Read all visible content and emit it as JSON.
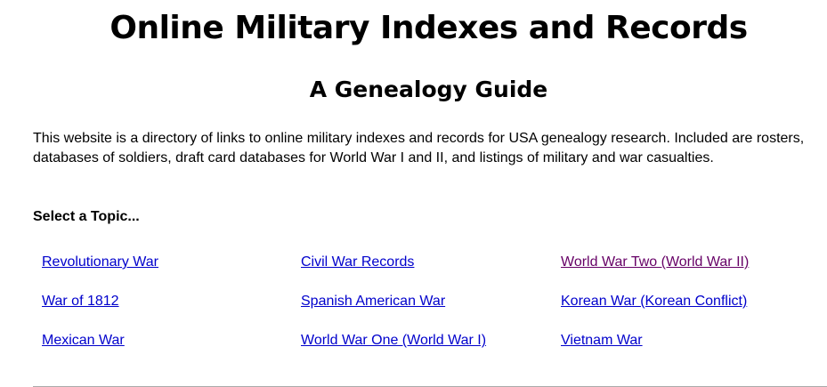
{
  "header": {
    "title": "Online Military Indexes and Records",
    "subtitle": "A Genealogy Guide"
  },
  "intro": {
    "text": "This website is a directory of links to online military indexes and records for USA genealogy research. Included are rosters, databases of soldiers, draft card databases for World War I and II, and listings of military and war casualties."
  },
  "topics": {
    "heading": "Select a Topic...",
    "link_color": "#0000cc",
    "visited_color": "#660066",
    "rows": [
      [
        {
          "label": "Revolutionary War",
          "visited": false
        },
        {
          "label": "Civil War Records",
          "visited": false
        },
        {
          "label": "World War Two (World War II)",
          "visited": true
        }
      ],
      [
        {
          "label": "War of 1812",
          "visited": false
        },
        {
          "label": "Spanish American War",
          "visited": false
        },
        {
          "label": "Korean War (Korean Conflict)",
          "visited": false
        }
      ],
      [
        {
          "label": "Mexican War",
          "visited": false
        },
        {
          "label": "World War One (World War I)",
          "visited": false
        },
        {
          "label": "Vietnam War",
          "visited": false
        }
      ]
    ]
  }
}
